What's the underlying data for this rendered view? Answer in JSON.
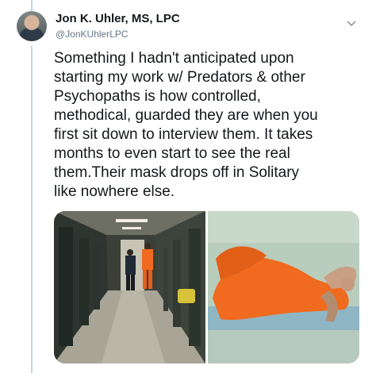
{
  "tweet": {
    "author_name": "Jon K. Uhler, MS, LPC",
    "handle": "@JonKUhlerLPC",
    "text_lines": [
      "Something I hadn't anticipated upon",
      "starting my work w/ Predators & other",
      "Psychopaths is how controlled,",
      "methodical, guarded they are when you",
      "first sit down to interview them. It takes",
      "months to even start to see the real",
      "them.Their mask drops off in Solitary",
      "like nowhere else."
    ]
  },
  "icons": {
    "menu": "chevron-down-icon",
    "avatar": "profile-photo"
  },
  "media": {
    "images": [
      "prison-corridor-photo",
      "solitary-cell-photo"
    ]
  },
  "colors": {
    "thread_line": "#c5d3df",
    "text": "#14171a",
    "secondary_text": "#657786",
    "jumpsuit_orange": "#f06a1f"
  }
}
